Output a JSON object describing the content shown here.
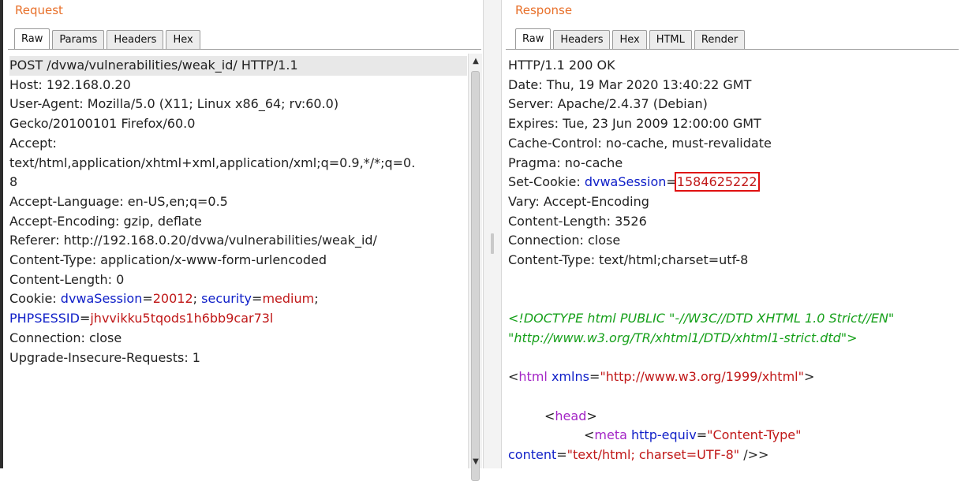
{
  "request": {
    "title": "Request",
    "tabs": [
      "Raw",
      "Params",
      "Headers",
      "Hex"
    ],
    "active_tab": "Raw",
    "lines": {
      "l1": "POST /dvwa/vulnerabilities/weak_id/ HTTP/1.1",
      "l2": "Host: 192.168.0.20",
      "l3": "User-Agent: Mozilla/5.0 (X11; Linux x86_64; rv:60.0)",
      "l4": "Gecko/20100101 Firefox/60.0",
      "l5": "Accept:",
      "l6": "text/html,application/xhtml+xml,application/xml;q=0.9,*/*;q=0.",
      "l7": "8",
      "l8": "Accept-Language: en-US,en;q=0.5",
      "l9": "Accept-Encoding: gzip, deflate",
      "l10": "Referer: http://192.168.0.20/dvwa/vulnerabilities/weak_id/",
      "l11": "Content-Type: application/x-www-form-urlencoded",
      "l12": "Content-Length: 0",
      "cookie_label": "Cookie: ",
      "cookie_name1": "dvwaSession",
      "eq": "=",
      "cookie_val1": "20012",
      "sep": "; ",
      "cookie_name2": "security",
      "cookie_val2": "medium",
      "semi": ";",
      "cookie_name3": "PHPSESSID",
      "cookie_val3": "jhvvikku5tqods1h6bb9car73l",
      "l15": "Connection: close",
      "l16": "Upgrade-Insecure-Requests: 1"
    }
  },
  "response": {
    "title": "Response",
    "tabs": [
      "Raw",
      "Headers",
      "Hex",
      "HTML",
      "Render"
    ],
    "active_tab": "Raw",
    "lines": {
      "l1": "HTTP/1.1 200 OK",
      "l2": "Date: Thu, 19 Mar 2020 13:40:22 GMT",
      "l3": "Server: Apache/2.4.37 (Debian)",
      "l4": "Expires: Tue, 23 Jun 2009 12:00:00 GMT",
      "l5": "Cache-Control: no-cache, must-revalidate",
      "l6": "Pragma: no-cache",
      "setcookie_label": "Set-Cookie: ",
      "setcookie_name": "dvwaSession",
      "eq": "=",
      "setcookie_val": "1584625222",
      "l8": "Vary: Accept-Encoding",
      "l9": "Content-Length: 3526",
      "l10": "Connection: close",
      "l11": "Content-Type: text/html;charset=utf-8",
      "doctype1": "<!DOCTYPE html PUBLIC \"-//W3C//DTD XHTML 1.0 Strict//EN\"",
      "doctype2": "\"http://www.w3.org/TR/xhtml1/DTD/xhtml1-strict.dtd\">",
      "lt": "<",
      "gt": ">",
      "html_tag": "html",
      "xmlns_attr": "xmlns",
      "xmlns_val": "\"http://www.w3.org/1999/xhtml\"",
      "head_tag": "head",
      "meta_tag": "meta",
      "httpequiv_attr": "http-equiv",
      "httpequiv_val": "\"Content-Type\"",
      "content_attr": "content",
      "content_val": "\"text/html; charset=UTF-8\"",
      "selfclose": " />"
    }
  },
  "colors": {
    "title_orange": "#e8702a",
    "cookie_name_blue": "#1020c8",
    "cookie_value_red": "#c01818",
    "doctype_green": "#16a01a",
    "tag_purple": "#a426c6",
    "highlight_box": "#e01010"
  }
}
